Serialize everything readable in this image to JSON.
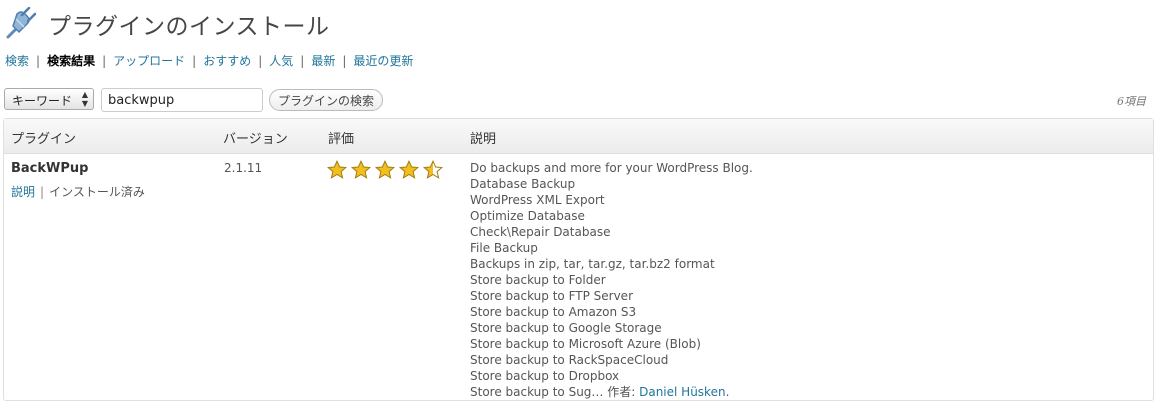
{
  "header": {
    "title": "プラグインのインストール",
    "icon": "plugin-plug-icon"
  },
  "subnav": {
    "items": [
      {
        "label": "検索",
        "current": false
      },
      {
        "label": "検索結果",
        "current": true
      },
      {
        "label": "アップロード",
        "current": false
      },
      {
        "label": "おすすめ",
        "current": false
      },
      {
        "label": "人気",
        "current": false
      },
      {
        "label": "最新",
        "current": false
      },
      {
        "label": "最近の更新",
        "current": false
      }
    ],
    "separator": "|"
  },
  "search": {
    "type_select": {
      "value": "キーワード"
    },
    "query": "backwpup",
    "button_label": "プラグインの検索"
  },
  "count_label": "6項目",
  "table": {
    "columns": [
      "プラグイン",
      "バージョン",
      "評価",
      "説明"
    ],
    "rows": [
      {
        "name": "BackWPup",
        "details_link": "説明",
        "status": "インストール済み",
        "version": "2.1.11",
        "rating": 4.5,
        "rating_max": 5,
        "description_lines": [
          "Do backups and more for your WordPress Blog.",
          "Database Backup",
          "WordPress XML Export",
          "Optimize Database",
          "Check\\Repair Database",
          "File Backup",
          "Backups in zip, tar, tar.gz, tar.bz2 format",
          "Store backup to Folder",
          "Store backup to FTP Server",
          "Store backup to Amazon S3",
          "Store backup to Google Storage",
          "Store backup to Microsoft Azure (Blob)",
          "Store backup to RackSpaceCloud",
          "Store backup to Dropbox"
        ],
        "description_last": "Store backup to Sug…",
        "author_prefix": " 作者: ",
        "author": "Daniel Hüsken",
        "author_suffix": "."
      }
    ]
  },
  "colors": {
    "link": "#21759b",
    "star": "#f2c01e"
  }
}
